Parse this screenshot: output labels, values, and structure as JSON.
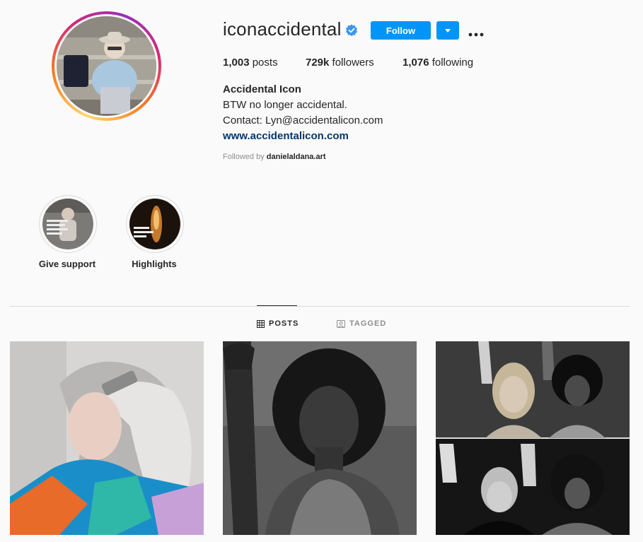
{
  "profile": {
    "username": "iconaccidental",
    "verified": true,
    "follow_label": "Follow",
    "stats": {
      "posts_count": "1,003",
      "posts_label": "posts",
      "followers_count": "729k",
      "followers_label": "followers",
      "following_count": "1,076",
      "following_label": "following"
    },
    "full_name": "Accidental Icon",
    "bio_line1": "BTW no longer accidental.",
    "bio_line2": "Contact: Lyn@accidentalicon.com",
    "website": "www.accidentalicon.com",
    "followed_by_prefix": "Followed by",
    "followed_by_user": "danielaldana.art"
  },
  "highlights": [
    {
      "label": "Give support"
    },
    {
      "label": "Highlights"
    }
  ],
  "tabs": {
    "posts": "POSTS",
    "tagged": "TAGGED"
  },
  "colors": {
    "accent": "#0095f6",
    "link": "#00376b",
    "muted": "#8e8e8e",
    "background": "#fafafa"
  },
  "icons": [
    "verified-badge-icon",
    "chevron-down-icon",
    "more-options-icon",
    "grid-icon",
    "tagged-icon"
  ]
}
